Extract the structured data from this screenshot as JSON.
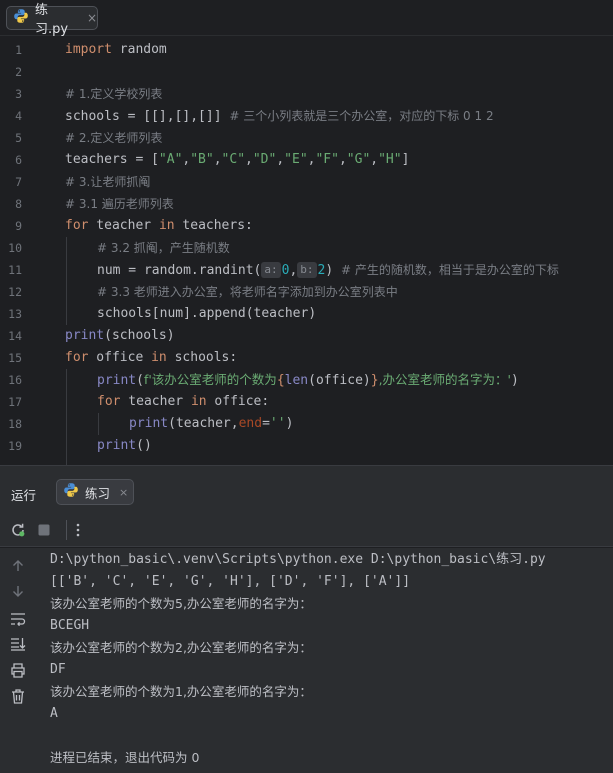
{
  "editor_tab": {
    "filename": "练习.py",
    "close": "×"
  },
  "gutter": {
    "line_numbers": [
      "1",
      "2",
      "3",
      "4",
      "5",
      "6",
      "7",
      "8",
      "9",
      "10",
      "11",
      "12",
      "13",
      "14",
      "15",
      "16",
      "17",
      "18",
      "19"
    ]
  },
  "code": {
    "l1": {
      "kw": "import",
      "rest": " random"
    },
    "l3": {
      "comment": "# 1.定义学校列表"
    },
    "l4": {
      "code": "schools = [[],[],[]] ",
      "comment": "# 三个小列表就是三个办公室，对应的下标 0 1 2"
    },
    "l5": {
      "comment": "# 2.定义老师列表"
    },
    "l6": {
      "pre": "teachers = [",
      "items": [
        "\"A\"",
        "\"B\"",
        "\"C\"",
        "\"D\"",
        "\"E\"",
        "\"F\"",
        "\"G\"",
        "\"H\""
      ],
      "sep": ",",
      "post": "]"
    },
    "l7": {
      "comment": "# 3.让老师抓阄"
    },
    "l8": {
      "comment": "# 3.1 遍历老师列表"
    },
    "l9": {
      "kw1": "for",
      "mid1": " teacher ",
      "kw2": "in",
      "mid2": " teachers:"
    },
    "l10": {
      "comment": "# 3.2 抓阄，产生随机数"
    },
    "l11": {
      "pre": "num = random.randint(",
      "hint_a": "a:",
      "val_a": "0",
      "sep": ",",
      "hint_b": "b:",
      "val_b": "2",
      "post": ") ",
      "comment": "# 产生的随机数，相当于是办公室的下标"
    },
    "l12": {
      "comment": "# 3.3 老师进入办公室，将老师名字添加到办公室列表中"
    },
    "l13": {
      "code": "schools[num].append(teacher)"
    },
    "l14": {
      "fn": "print",
      "rest": "(schools)"
    },
    "l15": {
      "kw1": "for",
      "mid1": " office ",
      "kw2": "in",
      "mid2": " schools:"
    },
    "l16": {
      "fn": "print",
      "open": "(",
      "str1": "f'该办公室老师的个数为",
      "brace_open": "{",
      "bi": "len",
      "arg": "(office)",
      "brace_close": "}",
      "str2": ",办公室老师的名字为：'",
      "close": ")"
    },
    "l17": {
      "kw1": "for",
      "mid1": " teacher ",
      "kw2": "in",
      "mid2": " office:"
    },
    "l18": {
      "fn": "print",
      "open": "(teacher,",
      "kwarg": "end",
      "eq": "=",
      "str": "''",
      "close": ")"
    },
    "l19": {
      "fn": "print",
      "rest": "()"
    }
  },
  "run_panel": {
    "title": "运行",
    "tab_label": "练习",
    "tab_close": "×"
  },
  "console": {
    "lines": [
      "D:\\python_basic\\.venv\\Scripts\\python.exe D:\\python_basic\\练习.py",
      "[['B', 'C', 'E', 'G', 'H'], ['D', 'F'], ['A']]",
      "该办公室老师的个数为5,办公室老师的名字为：",
      "BCEGH",
      "该办公室老师的个数为2,办公室老师的名字为：",
      "DF",
      "该办公室老师的个数为1,办公室老师的名字为：",
      "A",
      "",
      "进程已结束，退出代码为 0"
    ]
  },
  "colors": {
    "background": "#1e1f22",
    "panel": "#2b2d30",
    "keyword": "#cf8e6d",
    "comment": "#7a7e85",
    "string": "#6aab73",
    "function": "#56a8f5",
    "number": "#2aacb8",
    "rerun_green": "#5fb865"
  },
  "icons": [
    "python-file-icon",
    "rerun-icon",
    "stop-icon",
    "more-vertical-icon",
    "arrow-up-icon",
    "arrow-down-icon",
    "soft-wrap-icon",
    "scroll-to-end-icon",
    "print-icon",
    "trash-icon"
  ]
}
